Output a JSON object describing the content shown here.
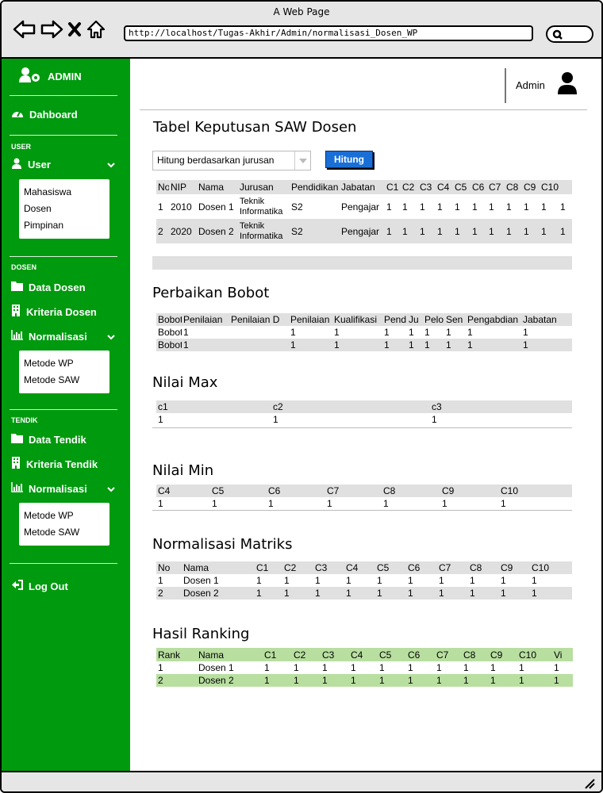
{
  "window": {
    "title": "A Web Page",
    "url": "http://localhost/Tugas-Akhir/Admin/normalisasi_Dosen_WP"
  },
  "sidebar": {
    "brand": "ADMIN",
    "dashboard": "Dahboard",
    "sections": {
      "user": "USER",
      "dosen": "DOSEN",
      "tendik": "TENDIK"
    },
    "user_menu": "User",
    "user_sub": [
      "Mahasiswa",
      "Dosen",
      "Pimpinan"
    ],
    "data_dosen": "Data Dosen",
    "kriteria_dosen": "Kriteria Dosen",
    "normalisasi": "Normalisasi",
    "metode_sub": [
      "Metode WP",
      "Metode SAW"
    ],
    "data_tendik": "Data Tendik",
    "kriteria_tendik": "Kriteria Tendik",
    "logout": "Log Out",
    "accent": "#009a0e"
  },
  "header": {
    "user_label": "Admin"
  },
  "keputusan": {
    "title": "Tabel Keputusan SAW Dosen",
    "select_value": "Hitung berdasarkan jurusan",
    "button": "Hitung",
    "columns": [
      "No",
      "NIP",
      "Nama",
      "Jurusan",
      "Pendidikan",
      "Jabatan",
      "C1",
      "C2",
      "C3",
      "C4",
      "C5",
      "C6",
      "C7",
      "C8",
      "C9",
      "C10",
      ""
    ],
    "rows": [
      [
        "1",
        "2010",
        "Dosen 1",
        "Teknik Informatika",
        "S2",
        "Pengajar",
        "1",
        "1",
        "1",
        "1",
        "1",
        "1",
        "1",
        "1",
        "1",
        "1",
        "1"
      ],
      [
        "2",
        "2020",
        "Dosen 2",
        "Teknik Informatika",
        "S2",
        "Pengajar",
        "1",
        "1",
        "1",
        "1",
        "1",
        "1",
        "1",
        "1",
        "1",
        "1",
        "1"
      ]
    ]
  },
  "bobot": {
    "title": "Perbaikan Bobot",
    "columns": [
      "Bobot",
      "Penilaian",
      "Penilaian D",
      "Penilaian",
      "Kualifikasi",
      "Pend",
      "Ju",
      "Pelo",
      "Sen",
      "Pengabdian",
      "Jabatan"
    ],
    "rows": [
      [
        "Bobot 1",
        "1",
        "",
        "1",
        "1",
        "1",
        "1",
        "1",
        "1",
        "1",
        "1"
      ],
      [
        "Bobot 1",
        "1",
        "",
        "1",
        "1",
        "1",
        "1",
        "1",
        "1",
        "1",
        "1"
      ]
    ]
  },
  "nilai_max": {
    "title": "Nilai Max",
    "columns": [
      "c1",
      "c2",
      "c3"
    ],
    "row": [
      "1",
      "1",
      "1"
    ]
  },
  "nilai_min": {
    "title": "Nilai Min",
    "columns": [
      "C4",
      "C5",
      "C6",
      "C7",
      "C8",
      "C9",
      "C10"
    ],
    "row": [
      "1",
      "1",
      "1",
      "1",
      "1",
      "1",
      "1"
    ]
  },
  "normalisasi_matriks": {
    "title": "Normalisasi Matriks",
    "columns": [
      "No",
      "Nama",
      "C1",
      "C2",
      "C3",
      "C4",
      "C5",
      "C6",
      "C7",
      "C8",
      "C9",
      "C10"
    ],
    "rows": [
      [
        "1",
        "Dosen 1",
        "1",
        "1",
        "1",
        "1",
        "1",
        "1",
        "1",
        "1",
        "1",
        "1"
      ],
      [
        "2",
        "Dosen 2",
        "1",
        "1",
        "1",
        "1",
        "1",
        "1",
        "1",
        "1",
        "1",
        "1"
      ]
    ]
  },
  "ranking": {
    "title": "Hasil Ranking",
    "columns": [
      "Rank",
      "Nama",
      "C1",
      "C2",
      "C3",
      "C4",
      "C5",
      "C6",
      "C7",
      "C8",
      "C9",
      "C10",
      "Vi"
    ],
    "rows": [
      [
        "1",
        "Dosen 1",
        "1",
        "1",
        "1",
        "1",
        "1",
        "1",
        "1",
        "1",
        "1",
        "1",
        "1"
      ],
      [
        "2",
        "Dosen 2",
        "1",
        "1",
        "1",
        "1",
        "1",
        "1",
        "1",
        "1",
        "1",
        "1",
        "1"
      ]
    ]
  }
}
